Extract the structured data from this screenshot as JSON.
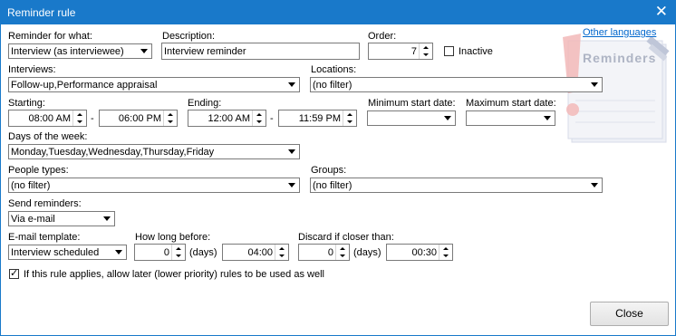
{
  "window": {
    "title": "Reminder rule"
  },
  "reminder_for": {
    "label": "Reminder for what:",
    "value": "Interview (as interviewee)"
  },
  "description": {
    "label": "Description:",
    "value": "Interview reminder"
  },
  "order": {
    "label": "Order:",
    "value": "7"
  },
  "inactive": {
    "label": "Inactive",
    "checked": false
  },
  "other_languages": "Other languages",
  "logo_text": "Reminders",
  "interviews": {
    "label": "Interviews:",
    "value": "Follow-up,Performance appraisal"
  },
  "locations": {
    "label": "Locations:",
    "value": "(no filter)"
  },
  "starting": {
    "label": "Starting:",
    "from": "08:00 AM",
    "to": "06:00 PM"
  },
  "ending": {
    "label": "Ending:",
    "from": "12:00 AM",
    "to": "11:59 PM"
  },
  "dash": "-",
  "min_start": {
    "label": "Minimum start date:",
    "value": ""
  },
  "max_start": {
    "label": "Maximum start date:",
    "value": ""
  },
  "days": {
    "label": "Days of the week:",
    "value": "Monday,Tuesday,Wednesday,Thursday,Friday"
  },
  "people_types": {
    "label": "People types:",
    "value": "(no filter)"
  },
  "groups": {
    "label": "Groups:",
    "value": "(no filter)"
  },
  "send_reminders": {
    "label": "Send reminders:",
    "value": "Via e-mail"
  },
  "email_template": {
    "label": "E-mail template:",
    "value": "Interview scheduled"
  },
  "how_long_before": {
    "label": "How long before:",
    "days": "0",
    "days_unit": "(days)",
    "time": "04:00"
  },
  "discard": {
    "label": "Discard if closer than:",
    "days": "0",
    "days_unit": "(days)",
    "time": "00:30"
  },
  "allow_later": {
    "label": "If this rule applies, allow later (lower priority) rules to be used as well",
    "checked": true
  },
  "close_button": "Close"
}
